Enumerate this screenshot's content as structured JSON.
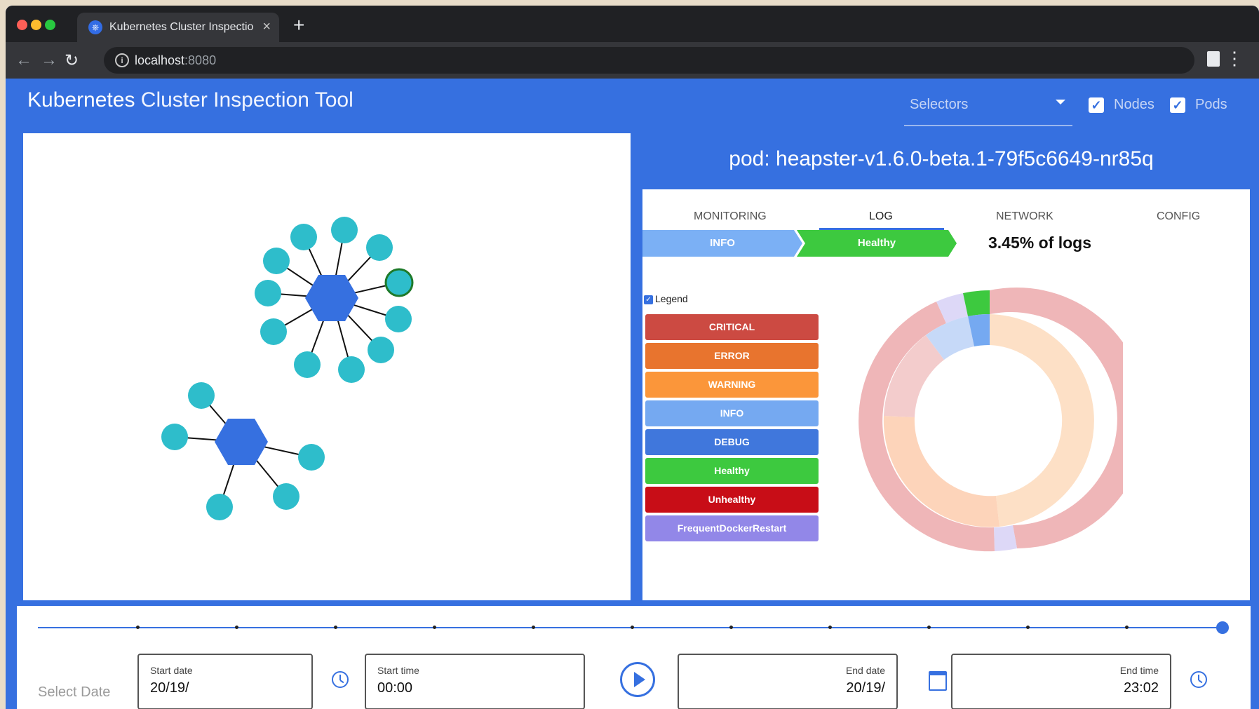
{
  "browser": {
    "tab_title": "Kubernetes Cluster Inspection",
    "tab_close": "×",
    "new_tab": "+",
    "url_host": "localhost",
    "url_port": ":8080",
    "info_glyph": "i",
    "kebab": "⋮",
    "back_glyph": "←",
    "forward_glyph": "→",
    "reload_glyph": "↻"
  },
  "app": {
    "title_bold": "Kubernetes",
    "title_rest": " Cluster Inspection Tool",
    "selectors_label": "Selectors",
    "nodes_label": "Nodes",
    "pods_label": "Pods",
    "check_glyph": "✓"
  },
  "detail": {
    "pod_title": "pod: heapster-v1.6.0-beta.1-79f5c6649-nr85q",
    "tabs": [
      "MONITORING",
      "LOG",
      "NETWORK",
      "CONFIG"
    ],
    "active_tab": "LOG",
    "breadcrumb": [
      "INFO",
      "Healthy"
    ],
    "percent_text": "3.45% of logs",
    "legend_label": "Legend",
    "legend_buttons": [
      {
        "label": "CRITICAL",
        "color": "#cc4a42"
      },
      {
        "label": "ERROR",
        "color": "#e8742e"
      },
      {
        "label": "WARNING",
        "color": "#fb963a"
      },
      {
        "label": "INFO",
        "color": "#75a9f1"
      },
      {
        "label": "DEBUG",
        "color": "#4077dc"
      },
      {
        "label": "Healthy",
        "color": "#3dc93f"
      },
      {
        "label": "Unhealthy",
        "color": "#c80d17"
      },
      {
        "label": "FrequentDockerRestart",
        "color": "#9287e8"
      }
    ]
  },
  "timeline": {
    "select_date_label": "Select Date",
    "start_date_label": "Start date",
    "start_date_value": "20/19/",
    "start_time_label": "Start time",
    "start_time_value": "00:00",
    "end_date_label": "End date",
    "end_date_value": "20/19/",
    "end_time_label": "End time",
    "end_time_value": "23:02",
    "slider_position_fraction": 1.0
  },
  "colors": {
    "primary": "#3670e0",
    "node_teal": "#2ebdcb",
    "highlight_node_border": "#1e7a2a"
  }
}
